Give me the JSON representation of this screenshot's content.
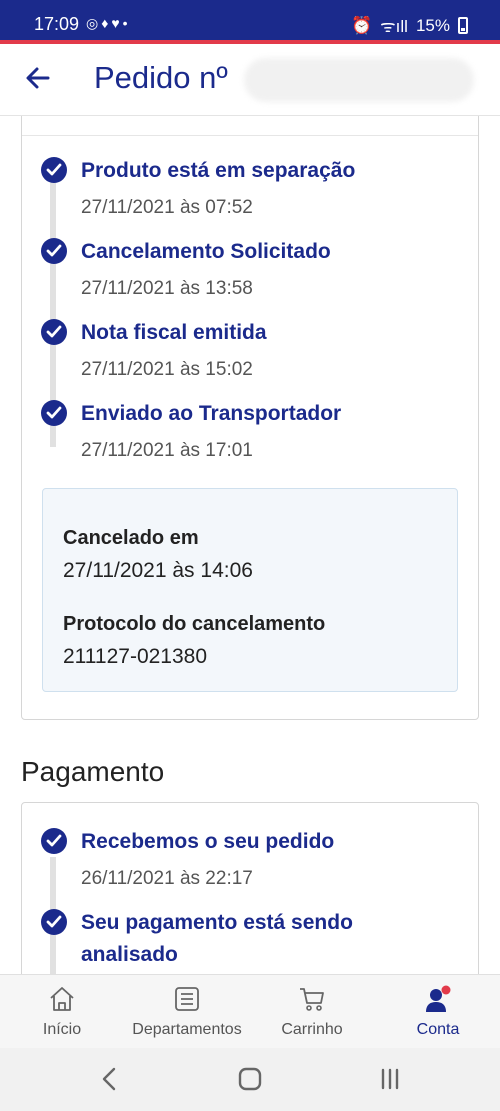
{
  "status_bar": {
    "time": "17:09",
    "battery": "15%"
  },
  "header": {
    "title": "Pedido nº"
  },
  "timeline_order": [
    {
      "title": "Produto está em separação",
      "date": "27/11/2021 às 07:52"
    },
    {
      "title": "Cancelamento Solicitado",
      "date": "27/11/2021 às 13:58"
    },
    {
      "title": "Nota fiscal emitida",
      "date": "27/11/2021 às 15:02"
    },
    {
      "title": "Enviado ao Transportador",
      "date": "27/11/2021 às 17:01"
    }
  ],
  "cancel_info": {
    "cancelled_label": "Cancelado em",
    "cancelled_value": "27/11/2021 às 14:06",
    "protocol_label": "Protocolo do cancelamento",
    "protocol_value": "211127-021380"
  },
  "payment": {
    "section_title": "Pagamento",
    "steps": [
      {
        "title": "Recebemos o seu pedido",
        "date": "26/11/2021 às 22:17"
      },
      {
        "title_line1": "Seu pagamento está sendo",
        "title_line2": "analisado"
      }
    ]
  },
  "bottom_nav": [
    {
      "label": "Início",
      "icon": "home-icon"
    },
    {
      "label": "Departamentos",
      "icon": "list-icon"
    },
    {
      "label": "Carrinho",
      "icon": "cart-icon"
    },
    {
      "label": "Conta",
      "icon": "account-icon"
    }
  ],
  "colors": {
    "primary": "#1b2a8c",
    "accent_red": "#e23a4a"
  }
}
